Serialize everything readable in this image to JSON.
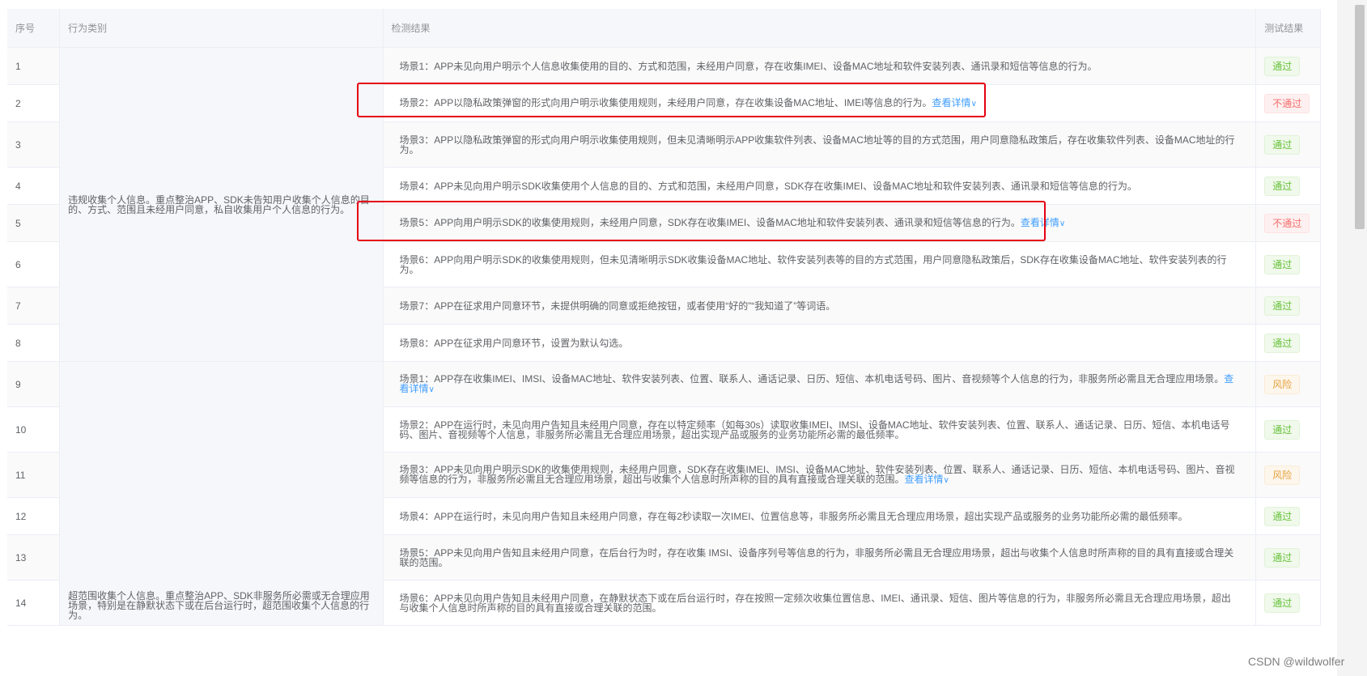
{
  "table": {
    "headers": {
      "index": "序号",
      "category": "行为类别",
      "result": "检测结果",
      "status": "测试结果"
    },
    "categories": [
      "违规收集个人信息。重点整治APP、SDK未告知用户收集个人信息的目的、方式、范围且未经用户同意，私自收集用户个人信息的行为。",
      "超范围收集个人信息。重点整治APP、SDK非服务所必需或无合理应用场景，特别是在静默状态下或在后台运行时，超范围收集个人信息的行为。"
    ],
    "detail_link": "查看详情",
    "rows": [
      {
        "index": "1",
        "text": "场景1：APP未见向用户明示个人信息收集使用的目的、方式和范围，未经用户同意，存在收集IMEI、设备MAC地址和软件安装列表、通讯录和短信等信息的行为。",
        "link": false,
        "status": "通过",
        "tone": "pass"
      },
      {
        "index": "2",
        "text": "场景2：APP以隐私政策弹窗的形式向用户明示收集使用规则，未经用户同意，存在收集设备MAC地址、IMEI等信息的行为。",
        "link": true,
        "status": "不通过",
        "tone": "fail"
      },
      {
        "index": "3",
        "text": "场景3：APP以隐私政策弹窗的形式向用户明示收集使用规则，但未见清晰明示APP收集软件列表、设备MAC地址等的目的方式范围，用户同意隐私政策后，存在收集软件列表、设备MAC地址的行为。",
        "link": false,
        "status": "通过",
        "tone": "pass"
      },
      {
        "index": "4",
        "text": "场景4：APP未见向用户明示SDK收集使用个人信息的目的、方式和范围，未经用户同意，SDK存在收集IMEI、设备MAC地址和软件安装列表、通讯录和短信等信息的行为。",
        "link": false,
        "status": "通过",
        "tone": "pass"
      },
      {
        "index": "5",
        "text": "场景5：APP向用户明示SDK的收集使用规则，未经用户同意，SDK存在收集IMEI、设备MAC地址和软件安装列表、通讯录和短信等信息的行为。",
        "link": true,
        "status": "不通过",
        "tone": "fail"
      },
      {
        "index": "6",
        "text": "场景6：APP向用户明示SDK的收集使用规则，但未见清晰明示SDK收集设备MAC地址、软件安装列表等的目的方式范围，用户同意隐私政策后，SDK存在收集设备MAC地址、软件安装列表的行为。",
        "link": false,
        "status": "通过",
        "tone": "pass"
      },
      {
        "index": "7",
        "text": "场景7：APP在征求用户同意环节，未提供明确的同意或拒绝按钮，或者使用“好的”“我知道了”等词语。",
        "link": false,
        "status": "通过",
        "tone": "pass"
      },
      {
        "index": "8",
        "text": "场景8：APP在征求用户同意环节，设置为默认勾选。",
        "link": false,
        "status": "通过",
        "tone": "pass"
      },
      {
        "index": "9",
        "text": "场景1：APP存在收集IMEI、IMSI、设备MAC地址、软件安装列表、位置、联系人、通话记录、日历、短信、本机电话号码、图片、音视频等个人信息的行为，非服务所必需且无合理应用场景。",
        "link": true,
        "status": "风险",
        "tone": "risk"
      },
      {
        "index": "10",
        "text": "场景2：APP在运行时，未见向用户告知且未经用户同意，存在以特定频率（如每30s）读取收集IMEI、IMSI、设备MAC地址、软件安装列表、位置、联系人、通话记录、日历、短信、本机电话号码、图片、音视频等个人信息，非服务所必需且无合理应用场景，超出实现产品或服务的业务功能所必需的最低频率。",
        "link": false,
        "status": "通过",
        "tone": "pass"
      },
      {
        "index": "11",
        "text": "场景3：APP未见向用户明示SDK的收集使用规则，未经用户同意，SDK存在收集IMEI、IMSI、设备MAC地址、软件安装列表、位置、联系人、通话记录、日历、短信、本机电话号码、图片、音视频等信息的行为，非服务所必需且无合理应用场景，超出与收集个人信息时所声称的目的具有直接或合理关联的范围。",
        "link": true,
        "status": "风险",
        "tone": "risk"
      },
      {
        "index": "12",
        "text": "场景4：APP在运行时，未见向用户告知且未经用户同意，存在每2秒读取一次IMEI、位置信息等，非服务所必需且无合理应用场景，超出实现产品或服务的业务功能所必需的最低频率。",
        "link": false,
        "status": "通过",
        "tone": "pass"
      },
      {
        "index": "13",
        "text": "场景5：APP未见向用户告知且未经用户同意，在后台行为时，存在收集 IMSI、设备序列号等信息的行为，非服务所必需且无合理应用场景，超出与收集个人信息时所声称的目的具有直接或合理关联的范围。",
        "link": false,
        "status": "通过",
        "tone": "pass"
      },
      {
        "index": "14",
        "text": "场景6：APP未见向用户告知且未经用户同意，在静默状态下或在后台运行时，存在按照一定频次收集位置信息、IMEI、通讯录、短信、图片等信息的行为，非服务所必需且无合理应用场景，超出与收集个人信息时所声称的目的具有直接或合理关联的范围。",
        "link": false,
        "status": "通过",
        "tone": "pass"
      }
    ]
  },
  "watermark": "CSDN @wildwolfer"
}
